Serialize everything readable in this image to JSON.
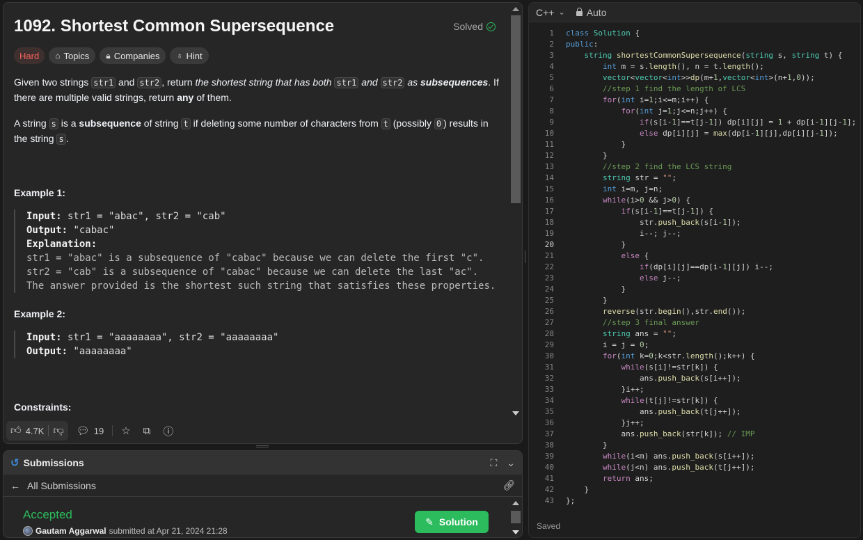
{
  "problem": {
    "title": "1092. Shortest Common Supersequence",
    "solved_label": "Solved",
    "tags": [
      "Hard",
      "Topics",
      "Companies",
      "Hint"
    ],
    "p1": {
      "a": "Given two strings ",
      "code1": "str1",
      "b": " and ",
      "code2": "str2",
      "c": ", return ",
      "italic1": "the shortest string that has both ",
      "code3": "str1",
      "italic2": " and ",
      "code4": "str2",
      "italic3": " as ",
      "bold1": "subsequences",
      "d": ". If there are multiple valid strings, return ",
      "bold2": "any",
      "e": " of them."
    },
    "p2": {
      "a": "A string ",
      "code1": "s",
      "b": " is a ",
      "bold1": "subsequence",
      "c": " of string ",
      "code2": "t",
      "d": " if deleting some number of characters from ",
      "code3": "t",
      "e": " (possibly ",
      "code4": "0",
      "f": ") results in the string ",
      "code5": "s",
      "g": "."
    },
    "example1": {
      "title": "Example 1:",
      "input_label": "Input:",
      "input": " str1 = \"abac\", str2 = \"cab\"",
      "output_label": "Output:",
      "output": " \"cabac\"",
      "explanation_label": "Explanation:",
      "explanation": [
        "str1 = \"abac\" is a subsequence of \"cabac\" because we can delete the first \"c\".",
        "str2 = \"cab\" is a subsequence of \"cabac\" because we can delete the last \"ac\".",
        "The answer provided is the shortest such string that satisfies these properties."
      ]
    },
    "example2": {
      "title": "Example 2:",
      "input_label": "Input:",
      "input": " str1 = \"aaaaaaaa\", str2 = \"aaaaaaaa\"",
      "output_label": "Output:",
      "output": " \"aaaaaaaa\""
    },
    "constraints_title": "Constraints:"
  },
  "footer": {
    "likes": "4.7K",
    "comments": "19"
  },
  "submissions": {
    "title": "Submissions",
    "back_label": "All Submissions",
    "status": "Accepted",
    "user": "Gautam Aggarwal",
    "submitted_text": " submitted at Apr 21, 2024 21:28",
    "solution_button": "Solution"
  },
  "editor": {
    "language": "C++",
    "mode": "Auto",
    "status": "Saved",
    "current_line": 20
  },
  "colors": {
    "accent_green": "#2cbb5d",
    "hard_red": "#f8615c",
    "history_blue": "#3c8dde"
  }
}
